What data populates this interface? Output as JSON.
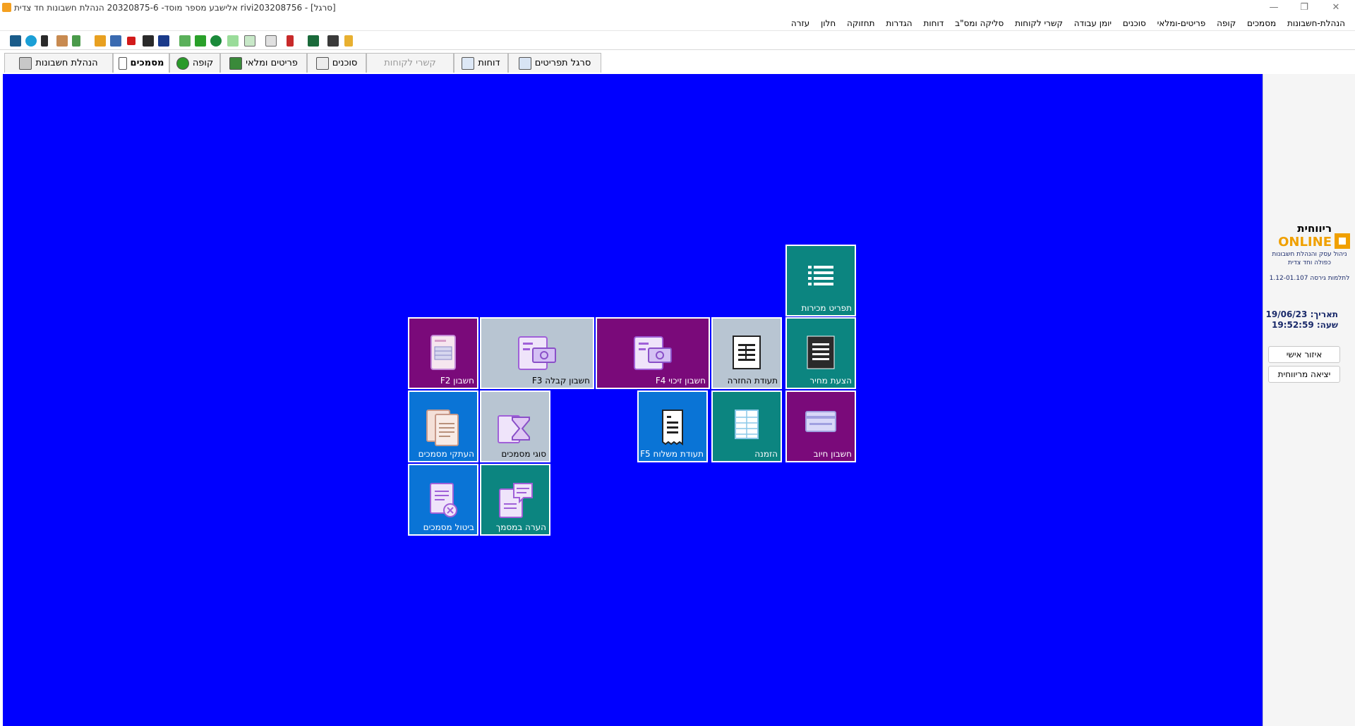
{
  "window": {
    "title": "[סרגל] - rivi203208756 אלישבע מספר מוסד- 20320875-6 הנהלת חשבונות  חד צדית"
  },
  "menu": [
    "הנהלת-חשבונות",
    "מסמכים",
    "קופה",
    "פריטים-ומלאי",
    "סוכנים",
    "יומן עבודה",
    "קשרי לקוחות",
    "סליקה ומס\"ב",
    "דוחות",
    "הגדרות",
    "תחזוקה",
    "חלון",
    "עזרה"
  ],
  "tabs": [
    {
      "label": "הנהלת חשבונות",
      "icon": "ledger-icon",
      "state": "normal"
    },
    {
      "label": "מסמכים",
      "icon": "clipboard-icon",
      "state": "active"
    },
    {
      "label": "קופה",
      "icon": "cash-register-icon",
      "state": "normal"
    },
    {
      "label": "פריטים ומלאי",
      "icon": "inventory-icon",
      "state": "normal"
    },
    {
      "label": "סוכנים",
      "icon": "agent-icon",
      "state": "normal"
    },
    {
      "label": "קשרי לקוחות",
      "icon": "",
      "state": "disabled"
    },
    {
      "label": "דוחות",
      "icon": "report-icon",
      "state": "normal"
    },
    {
      "label": "סרגל תפריטים",
      "icon": "menu-bar-icon",
      "state": "normal"
    }
  ],
  "tiles": {
    "sales_menu": "תפריט מכירות",
    "price_quote": "הצעת מחיר",
    "return_doc": "תעודת החזרה",
    "credit_invoice": "חשבון זיכוי F4",
    "receipt_invoice": "חשבון קבלה F3",
    "invoice": "חשבון F2",
    "debit_invoice": "חשבון חיוב",
    "order": "הזמנה",
    "delivery_note": "תעודת משלוח F5",
    "doc_types": "סוגי מסמכים",
    "doc_copies": "העתקי מסמכים",
    "doc_comment": "הערה במסמך",
    "doc_cancel": "ביטול מסמכים"
  },
  "side_panel": {
    "logo_word": "ריווחית",
    "logo_online": "ONLINE",
    "tagline": "ניהול עסק והנהלת חשבונות כפולה וחד צדית",
    "version": "לתלמות גירסה 1.12-01.107",
    "date_label": "תאריך:",
    "date_value": "19/06/23",
    "time_label": "שעה:",
    "time_value": "19:52:59",
    "personal_btn": "איזור אישי",
    "exit_btn": "יציאה מריווחית"
  },
  "colors": {
    "desktop": "#0000ff",
    "teal": "#0c8580",
    "purple": "#7a0a7a",
    "blue": "#0a74d6",
    "light": "#b8c5d2",
    "logo_orange": "#f0a000"
  }
}
